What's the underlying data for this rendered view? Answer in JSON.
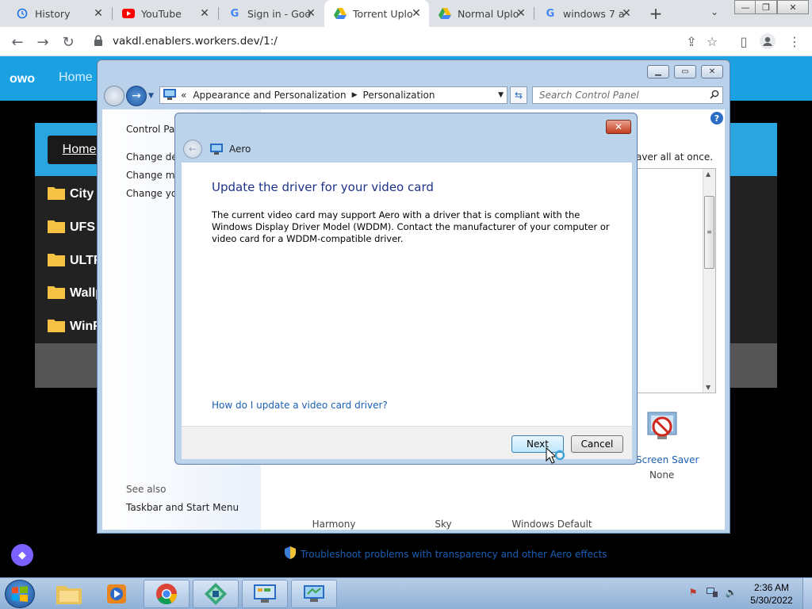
{
  "browser": {
    "tabs": [
      {
        "label": "History",
        "icon": "history-icon"
      },
      {
        "label": "YouTube",
        "icon": "youtube-icon"
      },
      {
        "label": "Sign in - Goo",
        "icon": "google-icon"
      },
      {
        "label": "Torrent Uplo",
        "icon": "google-drive-icon",
        "active": true
      },
      {
        "label": "Normal Uplo",
        "icon": "google-drive-icon"
      },
      {
        "label": "windows 7 a",
        "icon": "google-icon"
      }
    ],
    "url": "vakdl.enablers.workers.dev/1:/"
  },
  "page": {
    "brand": "owo",
    "nav_home": "Home",
    "home_button": "Home",
    "folders": [
      "City",
      "UFS",
      "ULTR",
      "Wallp",
      "WinF"
    ]
  },
  "control_panel": {
    "breadcrumb_prefix": "«",
    "breadcrumb": [
      "Appearance and Personalization",
      "Personalization"
    ],
    "search_placeholder": "Search Control Panel",
    "sidebar": {
      "home": "Control Pan",
      "links": [
        "Change des",
        "Change mo",
        "Change you"
      ],
      "see_also": "See also",
      "taskbar_link": "Taskbar and Start Menu"
    },
    "intro_fragment": "aver all at once.",
    "screen_saver_label": "Screen Saver",
    "screen_saver_value": "None",
    "themes": [
      "Harmony",
      "Sky",
      "Windows Default"
    ],
    "troubleshoot": "Troubleshoot problems with transparency and other Aero effects"
  },
  "dialog": {
    "app_title": "Aero",
    "heading": "Update the driver for your video card",
    "body": "The current video card may support Aero with a driver that is compliant with the Windows Display Driver Model (WDDM).  Contact the manufacturer of your computer or video card for a WDDM-compatible driver.",
    "help_link": "How do I update a video card driver?",
    "next": "Next",
    "cancel": "Cancel"
  },
  "taskbar": {
    "time": "2:36 AM",
    "date": "5/30/2022"
  },
  "colors": {
    "site_accent": "#1ba1e2",
    "link_blue": "#1a5fb4",
    "dialog_heading": "#1e3287"
  }
}
